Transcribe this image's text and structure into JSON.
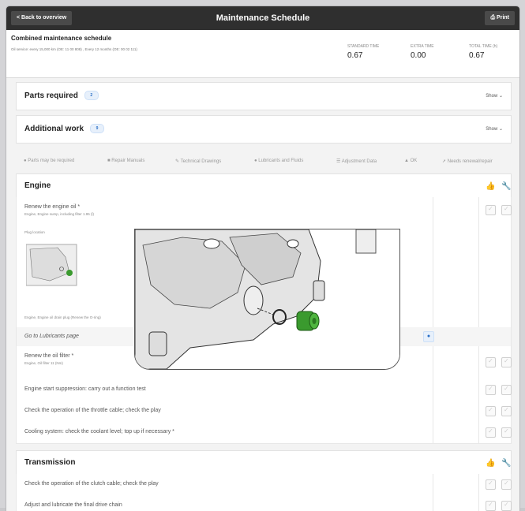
{
  "topbar": {
    "back_label": "< Back to overview",
    "title": "Maintenance Schedule",
    "print_label": "Print"
  },
  "summary": {
    "title": "Combined maintenance schedule",
    "subtitle": "Oil service: every 15,000 km (OE: 11 00 808) , Every 12 months (OE: 00 02 111)",
    "metrics": [
      {
        "label": "STANDARD TIME",
        "value": "0.67"
      },
      {
        "label": "EXTRA TIME",
        "value": "0.00"
      },
      {
        "label": "TOTAL TIME (h)",
        "value": "0.67"
      }
    ]
  },
  "parts": {
    "title": "Parts required",
    "count": "2",
    "show": "Show ⌄"
  },
  "additional": {
    "title": "Additional work",
    "count": "9",
    "show": "Show ⌄"
  },
  "legend": [
    "Parts may be required",
    "Repair Manuals",
    "Technical Drawings",
    "Lubricants and Fluids",
    "Adjustment Data",
    "OK",
    "Needs renewal/repair"
  ],
  "engine": {
    "title": "Engine",
    "rows": [
      {
        "text": "Renew the engine oil *",
        "sub": "Engine, Engine sump, including filter 1.95 (l)",
        "plug_location": "Plug location",
        "caption": "Engine, Engine oil drain plug (Renew the O-ring)"
      },
      {
        "text": "Go to Lubricants page"
      },
      {
        "text": "Renew the oil filter *",
        "sub": "Engine, Oil filter 11 (Nm)"
      },
      {
        "text": "Engine start suppression: carry out a function test"
      },
      {
        "text": "Check the operation of the throttle cable; check the play"
      },
      {
        "text": "Cooling system: check the coolant level; top up if necessary *"
      }
    ]
  },
  "transmission": {
    "title": "Transmission",
    "rows": [
      {
        "text": "Check the operation of the clutch cable; check the play"
      },
      {
        "text": "Adjust and lubricate the final drive chain"
      }
    ]
  },
  "colors": {
    "topbar": "#2f2f2f",
    "accent": "#2a6fc6",
    "part_green": "#3a9a2e"
  }
}
